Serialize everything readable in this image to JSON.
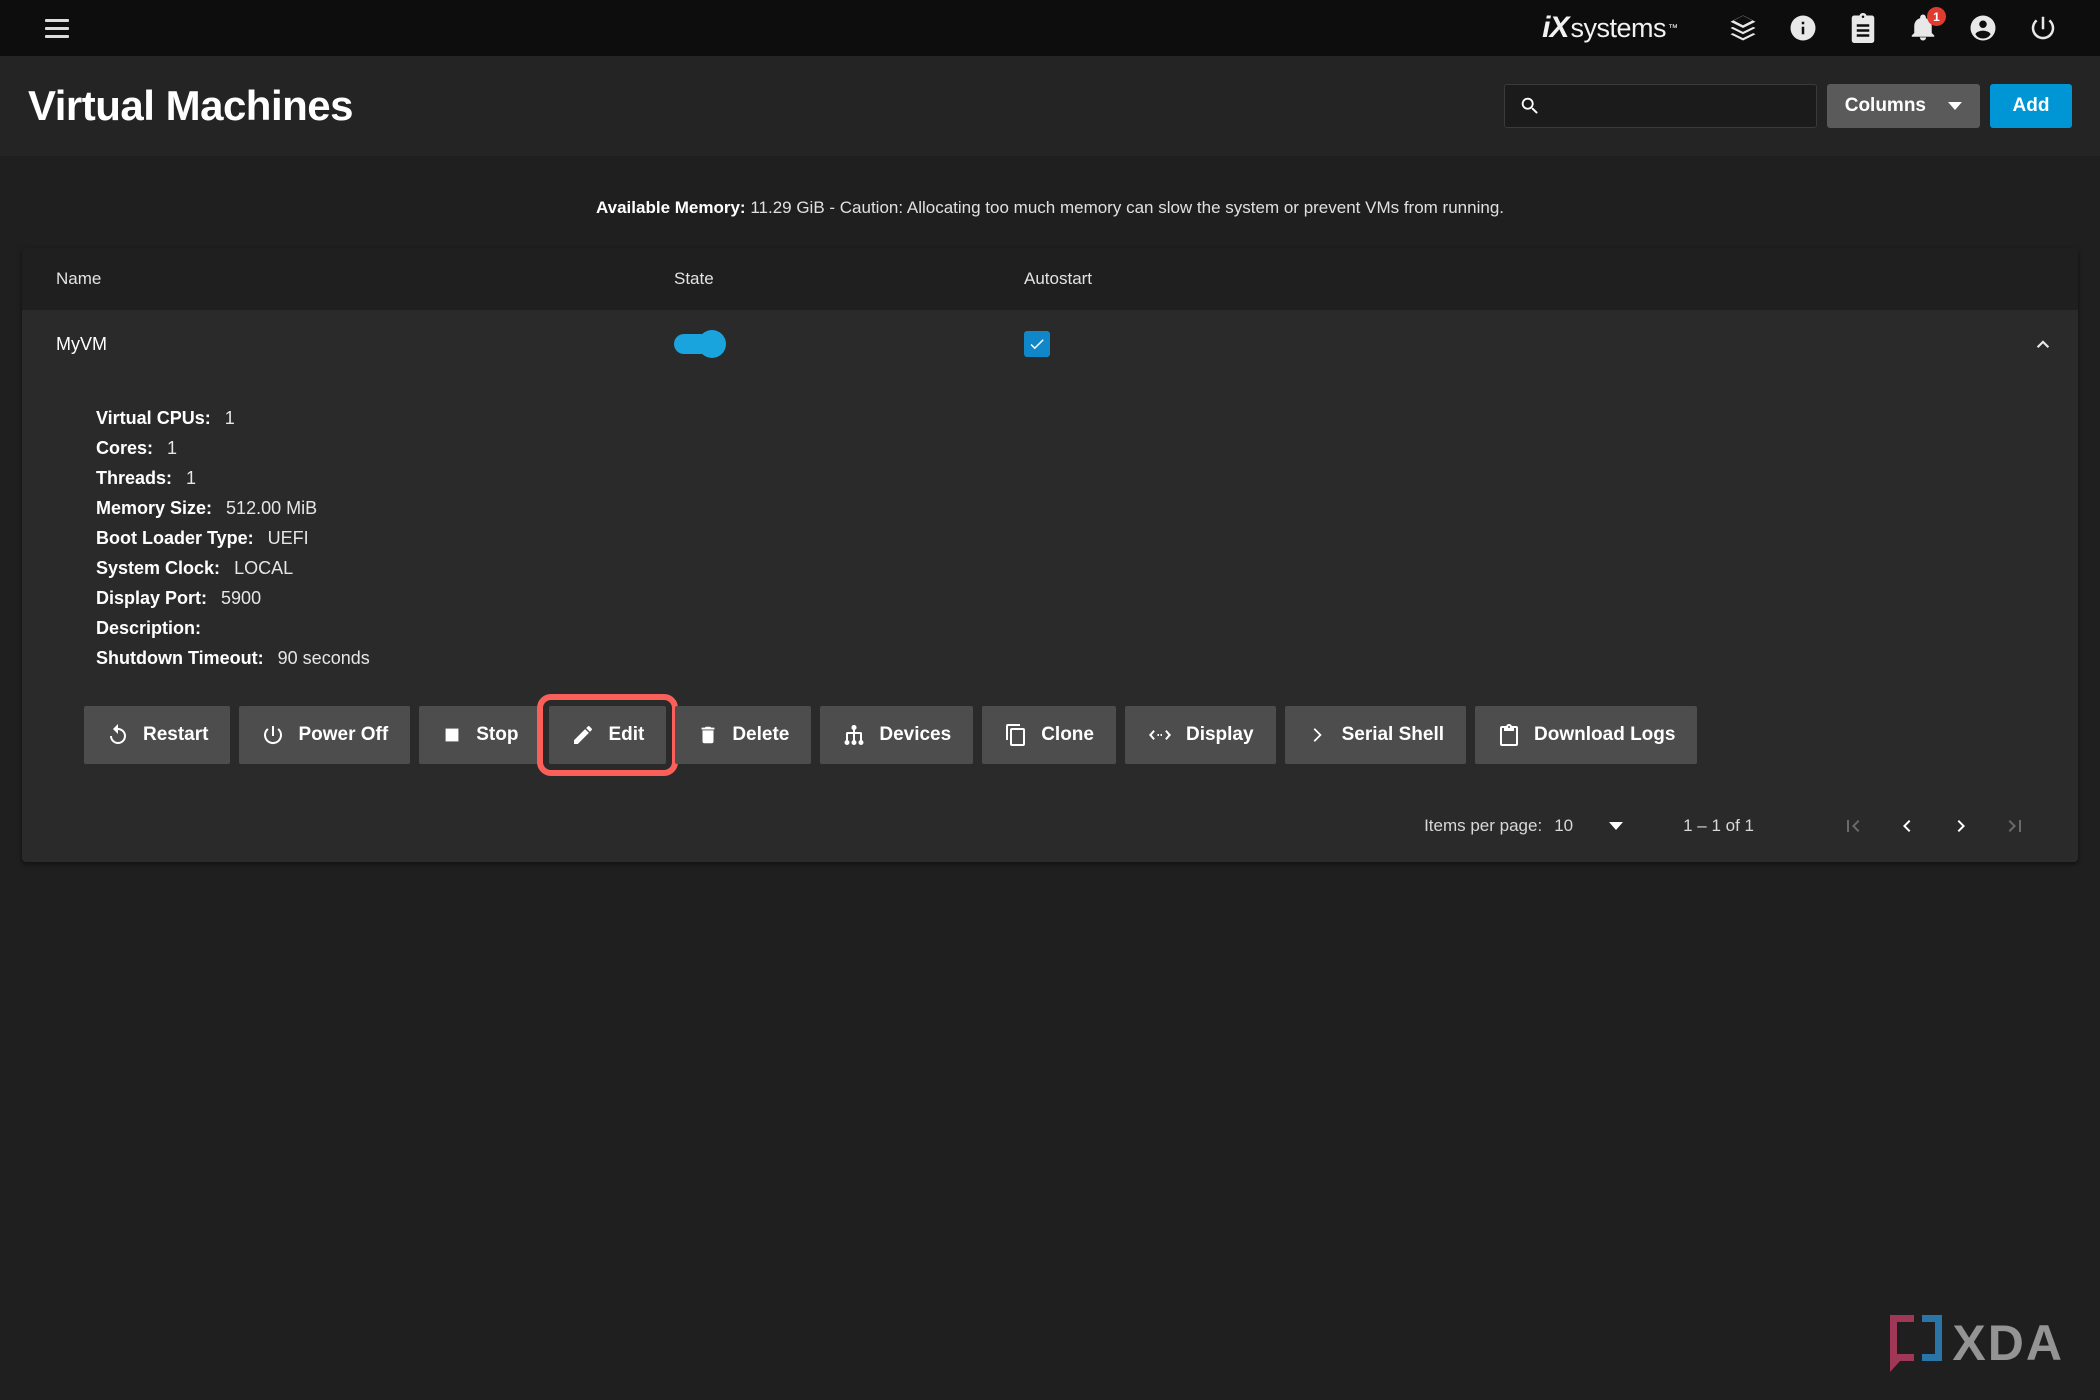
{
  "topbar": {
    "menu_icon": "hamburger-menu-icon",
    "brand_mark": "iX",
    "brand_text": "systems",
    "brand_tm": "™",
    "icons": [
      {
        "name": "apps-cube-icon",
        "label": "Apps"
      },
      {
        "name": "info-icon",
        "label": "Info"
      },
      {
        "name": "clipboard-icon",
        "label": "Jobs"
      },
      {
        "name": "bell-icon",
        "label": "Alerts",
        "badge": "1"
      },
      {
        "name": "account-circle-icon",
        "label": "Account"
      },
      {
        "name": "power-icon",
        "label": "Power"
      }
    ]
  },
  "header": {
    "title": "Virtual Machines",
    "search_placeholder": "",
    "search_value": "",
    "columns_label": "Columns",
    "add_label": "Add"
  },
  "notice": {
    "label": "Available Memory:",
    "text": " 11.29 GiB - Caution: Allocating too much memory can slow the system or prevent VMs from running."
  },
  "table": {
    "columns": [
      "Name",
      "State",
      "Autostart"
    ],
    "rows": [
      {
        "name": "MyVM",
        "state_on": true,
        "autostart_checked": true,
        "expanded": true
      }
    ]
  },
  "details": [
    {
      "label": "Virtual CPUs:",
      "value": "1"
    },
    {
      "label": "Cores:",
      "value": "1"
    },
    {
      "label": "Threads:",
      "value": "1"
    },
    {
      "label": "Memory Size:",
      "value": "512.00 MiB"
    },
    {
      "label": "Boot Loader Type:",
      "value": "UEFI"
    },
    {
      "label": "System Clock:",
      "value": "LOCAL"
    },
    {
      "label": "Display Port:",
      "value": "5900"
    },
    {
      "label": "Description:",
      "value": ""
    },
    {
      "label": "Shutdown Timeout:",
      "value": "90 seconds"
    }
  ],
  "actions": [
    {
      "label": "Restart",
      "icon": "restart-icon",
      "highlighted": false
    },
    {
      "label": "Power Off",
      "icon": "power-icon",
      "highlighted": false
    },
    {
      "label": "Stop",
      "icon": "stop-square-icon",
      "highlighted": false
    },
    {
      "label": "Edit",
      "icon": "pencil-icon",
      "highlighted": true
    },
    {
      "label": "Delete",
      "icon": "trash-icon",
      "highlighted": false
    },
    {
      "label": "Devices",
      "icon": "device-tree-icon",
      "highlighted": false
    },
    {
      "label": "Clone",
      "icon": "copy-icon",
      "highlighted": false
    },
    {
      "label": "Display",
      "icon": "display-arrows-icon",
      "highlighted": false
    },
    {
      "label": "Serial Shell",
      "icon": "chevron-right-icon",
      "highlighted": false
    },
    {
      "label": "Download Logs",
      "icon": "clipboard-icon",
      "highlighted": false
    }
  ],
  "paginator": {
    "items_per_page_label": "Items per page:",
    "items_per_page_value": "10",
    "range_label": "1 – 1 of 1",
    "first_icon": "first-page-icon",
    "prev_icon": "previous-page-icon",
    "next_icon": "next-page-icon",
    "last_icon": "last-page-icon"
  },
  "watermark": {
    "text": "XDA"
  },
  "colors": {
    "accent_blue": "#0095d5",
    "toggle_blue": "#1aa4de",
    "checkbox_blue": "#0f87c9",
    "highlight_red": "#fa5f5a",
    "badge_red": "#e13b2f",
    "page_bg": "#1f1f1f",
    "card_bg": "#2a2a2a",
    "topbar_bg": "#0d0d0d"
  }
}
